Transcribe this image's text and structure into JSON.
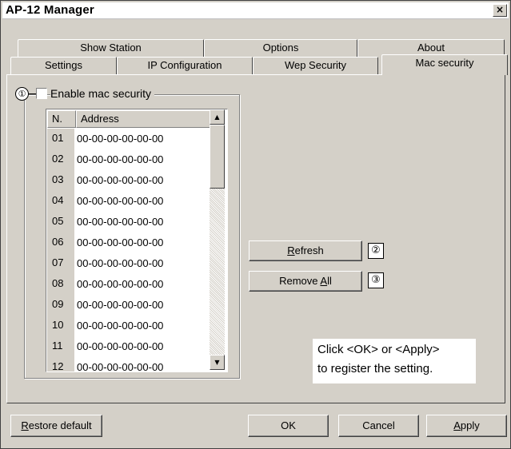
{
  "window": {
    "title": "AP-12 Manager",
    "close_glyph": "×"
  },
  "tabs": {
    "row_back": [
      "Show Station",
      "Options",
      "About"
    ],
    "row_front": [
      "Settings",
      "IP Configuration",
      "Wep Security",
      "Mac security"
    ],
    "active": "Mac security"
  },
  "mac_security": {
    "callout_1": "①",
    "enable_label": "Enable mac security",
    "enable_checked": false,
    "columns": [
      "N.",
      "Address"
    ],
    "rows": [
      {
        "n": "01",
        "address": "00-00-00-00-00-00"
      },
      {
        "n": "02",
        "address": "00-00-00-00-00-00"
      },
      {
        "n": "03",
        "address": "00-00-00-00-00-00"
      },
      {
        "n": "04",
        "address": "00-00-00-00-00-00"
      },
      {
        "n": "05",
        "address": "00-00-00-00-00-00"
      },
      {
        "n": "06",
        "address": "00-00-00-00-00-00"
      },
      {
        "n": "07",
        "address": "00-00-00-00-00-00"
      },
      {
        "n": "08",
        "address": "00-00-00-00-00-00"
      },
      {
        "n": "09",
        "address": "00-00-00-00-00-00"
      },
      {
        "n": "10",
        "address": "00-00-00-00-00-00"
      },
      {
        "n": "11",
        "address": "00-00-00-00-00-00"
      },
      {
        "n": "12",
        "address": "00-00-00-00-00-00"
      }
    ],
    "refresh_label_mnemonic": "R",
    "refresh_label_rest": "efresh",
    "callout_2": "②",
    "remove_all_label_pre": "Remove ",
    "remove_all_label_mnemonic": "A",
    "remove_all_label_rest": "ll",
    "callout_3": "③"
  },
  "note": {
    "line1": "Click <OK> or <Apply>",
    "line2": "to register the setting."
  },
  "footer": {
    "restore_mnemonic": "R",
    "restore_rest": "estore default",
    "ok": "OK",
    "cancel": "Cancel",
    "apply_mnemonic": "A",
    "apply_rest": "pply"
  },
  "scroll_up_glyph": "▲",
  "scroll_down_glyph": "▼"
}
